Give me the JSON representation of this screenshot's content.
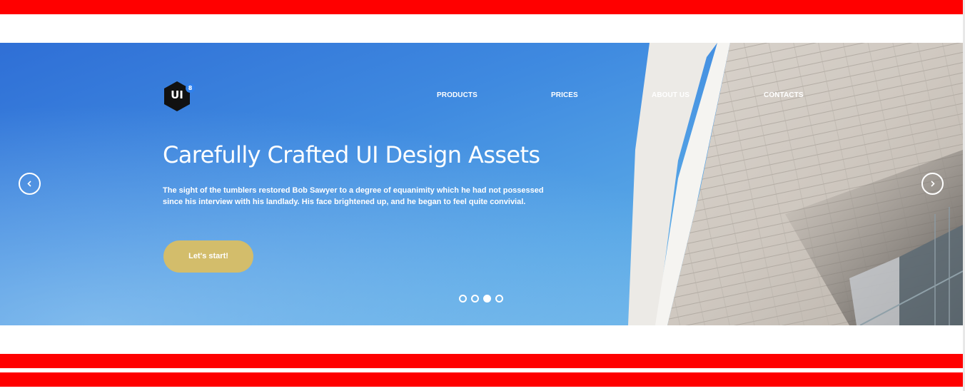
{
  "logo": {
    "text": "UI",
    "badge": "8",
    "color": "#111111",
    "badge_color": "#2f80ed"
  },
  "nav": {
    "items": [
      {
        "label": "PRODUCTS"
      },
      {
        "label": "PRICES"
      },
      {
        "label": "ABOUT US"
      },
      {
        "label": "CONTACTS"
      }
    ]
  },
  "hero": {
    "title": "Carefully Crafted UI Design Assets",
    "text": "The sight of the tumblers restored Bob Sawyer to a degree of equanimity which he had not possessed since his interview with his landlady. His face brightened up, and he began to feel quite convivial.",
    "cta_label": "Let's start!",
    "cta_color": "#d3bd6b"
  },
  "carousel": {
    "prev_icon": "chevron-left-icon",
    "next_icon": "chevron-right-icon",
    "slide_count": 4,
    "active_index": 2
  },
  "colors": {
    "accent_bar": "#ff0000",
    "sky": "#3f8ae0"
  }
}
